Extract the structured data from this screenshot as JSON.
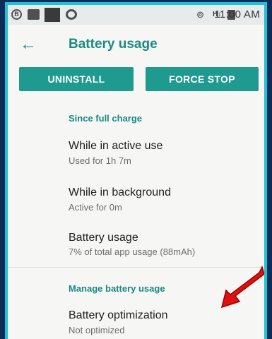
{
  "status_bar": {
    "time": "11:00 AM",
    "icons": [
      "b-icon",
      "image-icon",
      "square-icon",
      "ring-icon",
      "cast-icon",
      "sim-icon",
      "battery-icon"
    ]
  },
  "app_bar": {
    "back_icon": "arrow-left-icon",
    "title": "Battery usage"
  },
  "buttons": {
    "uninstall": "UNINSTALL",
    "force_stop": "FORCE STOP"
  },
  "sections": [
    {
      "header": "Since full charge",
      "items": [
        {
          "title": "While in active use",
          "subtitle": "Used for 1h 7m"
        },
        {
          "title": "While in background",
          "subtitle": "Active for 0m"
        },
        {
          "title": "Battery usage",
          "subtitle": "7% of total app usage (88mAh)"
        }
      ]
    },
    {
      "header": "Manage battery usage",
      "items": [
        {
          "title": "Battery optimization",
          "subtitle": "Not optimized"
        }
      ]
    }
  ],
  "colors": {
    "accent": "#1a8a83",
    "button": "#1f9a8f",
    "border": "#1fc2d9",
    "background": "#0d2c57",
    "annotation_arrow": "#e01010"
  }
}
